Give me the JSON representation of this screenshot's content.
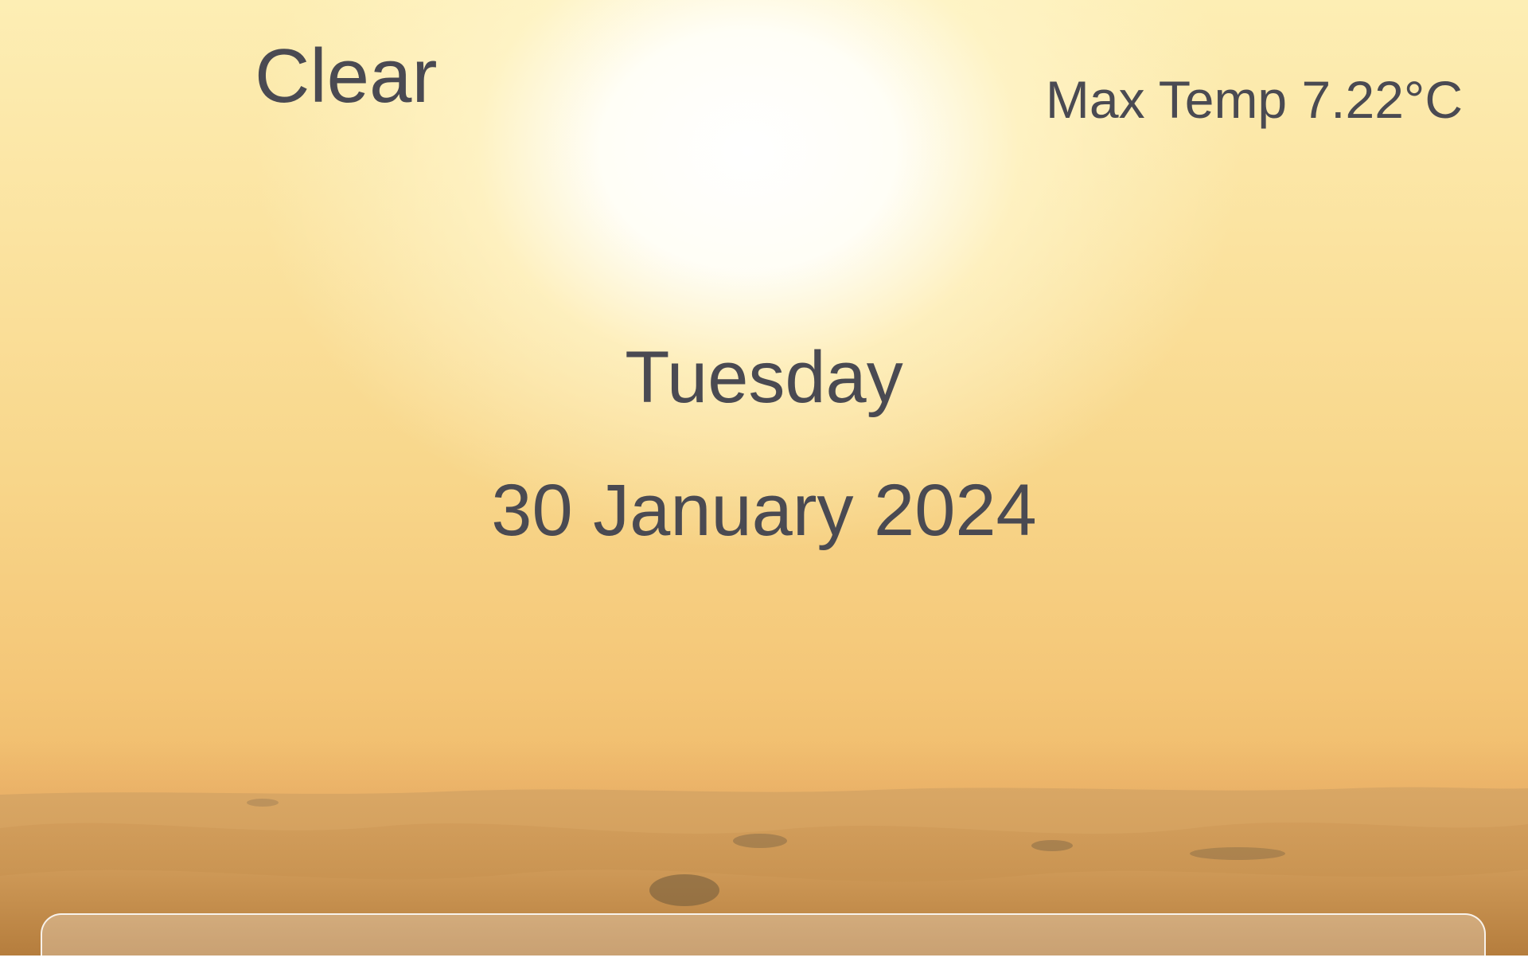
{
  "weather": {
    "condition": "Clear",
    "max_temp": "Max Temp 7.22°C"
  },
  "date": {
    "day": "Tuesday",
    "full_date": "30 January 2024"
  },
  "background": {
    "scene": "desert-sunset",
    "sky_color": "#fbe3a0",
    "sand_color": "#c99a5b"
  }
}
